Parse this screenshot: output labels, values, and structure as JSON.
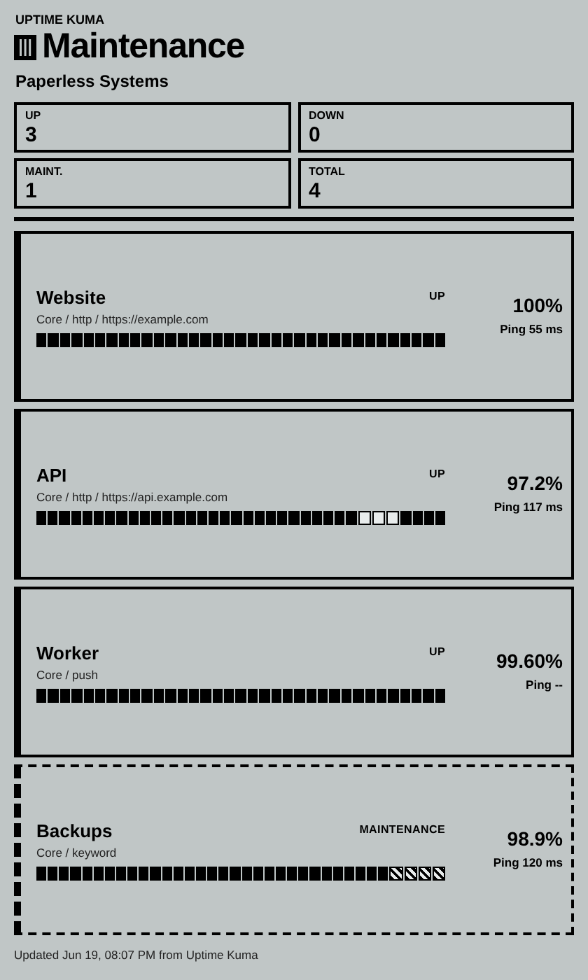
{
  "brand": "UPTIME KUMA",
  "title": "Maintenance",
  "subtitle": "Paperless Systems",
  "stats": [
    {
      "label": "UP",
      "value": "3"
    },
    {
      "label": "DOWN",
      "value": "0"
    },
    {
      "label": "MAINT.",
      "value": "1"
    },
    {
      "label": "TOTAL",
      "value": "4"
    }
  ],
  "monitors": [
    {
      "name": "Website",
      "kind": "up",
      "status": "UP",
      "detail": "Core / http / https://example.com",
      "uptime": "100%",
      "ping": "Ping 55 ms",
      "beats": [
        {
          "kind": "up"
        },
        {
          "kind": "up"
        },
        {
          "kind": "up"
        },
        {
          "kind": "up"
        },
        {
          "kind": "up"
        },
        {
          "kind": "up"
        },
        {
          "kind": "up"
        },
        {
          "kind": "up"
        },
        {
          "kind": "up"
        },
        {
          "kind": "up"
        },
        {
          "kind": "up"
        },
        {
          "kind": "up"
        },
        {
          "kind": "up"
        },
        {
          "kind": "up"
        },
        {
          "kind": "up"
        },
        {
          "kind": "up"
        },
        {
          "kind": "up"
        },
        {
          "kind": "up"
        },
        {
          "kind": "up"
        },
        {
          "kind": "up"
        },
        {
          "kind": "up"
        },
        {
          "kind": "up"
        },
        {
          "kind": "up"
        },
        {
          "kind": "up"
        },
        {
          "kind": "up"
        },
        {
          "kind": "up"
        },
        {
          "kind": "up"
        },
        {
          "kind": "up"
        },
        {
          "kind": "up"
        },
        {
          "kind": "up"
        },
        {
          "kind": "up"
        },
        {
          "kind": "up"
        },
        {
          "kind": "up"
        },
        {
          "kind": "up"
        },
        {
          "kind": "up"
        }
      ]
    },
    {
      "name": "API",
      "kind": "up",
      "status": "UP",
      "detail": "Core / http / https://api.example.com",
      "uptime": "97.2%",
      "ping": "Ping 117 ms",
      "beats": [
        {
          "kind": "up"
        },
        {
          "kind": "up"
        },
        {
          "kind": "up"
        },
        {
          "kind": "up"
        },
        {
          "kind": "up"
        },
        {
          "kind": "up"
        },
        {
          "kind": "up"
        },
        {
          "kind": "up"
        },
        {
          "kind": "up"
        },
        {
          "kind": "up"
        },
        {
          "kind": "up"
        },
        {
          "kind": "up"
        },
        {
          "kind": "up"
        },
        {
          "kind": "up"
        },
        {
          "kind": "up"
        },
        {
          "kind": "up"
        },
        {
          "kind": "up"
        },
        {
          "kind": "up"
        },
        {
          "kind": "up"
        },
        {
          "kind": "up"
        },
        {
          "kind": "up"
        },
        {
          "kind": "up"
        },
        {
          "kind": "up"
        },
        {
          "kind": "up"
        },
        {
          "kind": "up"
        },
        {
          "kind": "up"
        },
        {
          "kind": "up"
        },
        {
          "kind": "up"
        },
        {
          "kind": "down"
        },
        {
          "kind": "down"
        },
        {
          "kind": "down"
        },
        {
          "kind": "up"
        },
        {
          "kind": "up"
        },
        {
          "kind": "up"
        },
        {
          "kind": "up"
        }
      ]
    },
    {
      "name": "Worker",
      "kind": "up",
      "status": "UP",
      "detail": "Core / push",
      "uptime": "99.60%",
      "ping": "Ping --",
      "beats": [
        {
          "kind": "up"
        },
        {
          "kind": "up"
        },
        {
          "kind": "up"
        },
        {
          "kind": "up"
        },
        {
          "kind": "up"
        },
        {
          "kind": "up"
        },
        {
          "kind": "up"
        },
        {
          "kind": "up"
        },
        {
          "kind": "up"
        },
        {
          "kind": "up"
        },
        {
          "kind": "up"
        },
        {
          "kind": "up"
        },
        {
          "kind": "up"
        },
        {
          "kind": "up"
        },
        {
          "kind": "up"
        },
        {
          "kind": "up"
        },
        {
          "kind": "up"
        },
        {
          "kind": "up"
        },
        {
          "kind": "up"
        },
        {
          "kind": "up"
        },
        {
          "kind": "up"
        },
        {
          "kind": "up"
        },
        {
          "kind": "up"
        },
        {
          "kind": "up"
        },
        {
          "kind": "up"
        },
        {
          "kind": "up"
        },
        {
          "kind": "up"
        },
        {
          "kind": "up"
        },
        {
          "kind": "up"
        },
        {
          "kind": "up"
        },
        {
          "kind": "up"
        },
        {
          "kind": "up"
        },
        {
          "kind": "up"
        },
        {
          "kind": "up"
        },
        {
          "kind": "up"
        }
      ]
    },
    {
      "name": "Backups",
      "kind": "maintenance",
      "status": "MAINTENANCE",
      "detail": "Core / keyword",
      "uptime": "98.9%",
      "ping": "Ping 120 ms",
      "beats": [
        {
          "kind": "up"
        },
        {
          "kind": "up"
        },
        {
          "kind": "up"
        },
        {
          "kind": "up"
        },
        {
          "kind": "up"
        },
        {
          "kind": "up"
        },
        {
          "kind": "up"
        },
        {
          "kind": "up"
        },
        {
          "kind": "up"
        },
        {
          "kind": "up"
        },
        {
          "kind": "up"
        },
        {
          "kind": "up"
        },
        {
          "kind": "up"
        },
        {
          "kind": "up"
        },
        {
          "kind": "up"
        },
        {
          "kind": "up"
        },
        {
          "kind": "up"
        },
        {
          "kind": "up"
        },
        {
          "kind": "up"
        },
        {
          "kind": "up"
        },
        {
          "kind": "up"
        },
        {
          "kind": "up"
        },
        {
          "kind": "up"
        },
        {
          "kind": "up"
        },
        {
          "kind": "up"
        },
        {
          "kind": "up"
        },
        {
          "kind": "up"
        },
        {
          "kind": "up"
        },
        {
          "kind": "up"
        },
        {
          "kind": "up"
        },
        {
          "kind": "up"
        },
        {
          "kind": "maint"
        },
        {
          "kind": "maint"
        },
        {
          "kind": "maint"
        },
        {
          "kind": "maint"
        }
      ]
    }
  ],
  "footer": "Updated Jun 19, 08:07 PM from Uptime Kuma"
}
